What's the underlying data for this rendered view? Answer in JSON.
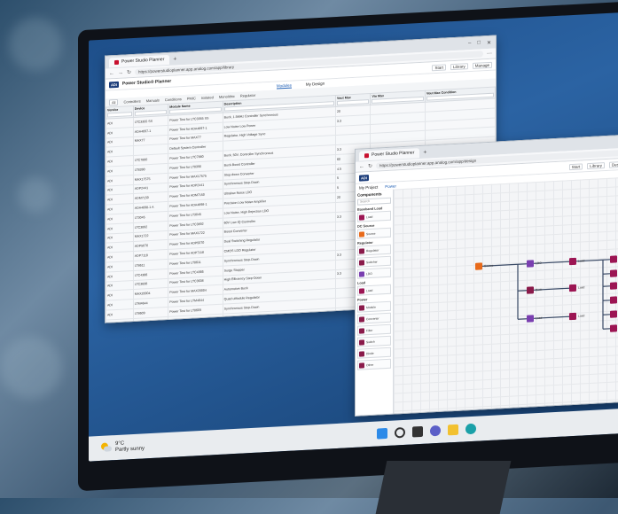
{
  "windowA": {
    "tab_title": "Power Studio Planner",
    "url": "https://powerstudioplanner.app.analog.com/app/library",
    "app_name": "Power Studio® Planner",
    "actions": [
      "Start",
      "Library",
      "Manage"
    ],
    "subtabs": [
      "Modules",
      "My Design"
    ],
    "filters": [
      "All",
      "Controllers",
      "Manuals",
      "Conditions",
      "PMIC",
      "Isolated",
      "Monolithic",
      "Regulator"
    ],
    "columns": [
      "Vendor",
      "Device",
      "Module Name",
      "Description",
      "Vout Max",
      "Vin Max",
      "Vout Max Condition"
    ],
    "rows": [
      [
        "ADI",
        "LTC3355 SS",
        "Power Test for LTC3355 SS",
        "Buck, 1.5MHz Controller Synchronous",
        "20",
        "",
        ""
      ],
      [
        "ADI",
        "ADA4897-1",
        "Power Test for ADA4897-1",
        "Low Noise Low Power",
        "3.3",
        "",
        ""
      ],
      [
        "ADI",
        "MAX77",
        "Power Test for MAX77",
        "Regulator, High Voltage Sync",
        "",
        "",
        ""
      ],
      [
        "ADI",
        "",
        "Default System Controller",
        "",
        "",
        "",
        ""
      ],
      [
        "ADI",
        "LTC7880",
        "Power Test for LTC7880",
        "Buck, 50V, Controller Synchronous",
        "3.3",
        "",
        ""
      ],
      [
        "ADI",
        "LT8390",
        "Power Test for LT8390",
        "Buck-Boost Controller",
        "60",
        "",
        ""
      ],
      [
        "ADI",
        "MAX17575",
        "Power Test for MAX17575",
        "Step-down Converter",
        "4.5",
        "",
        ""
      ],
      [
        "ADI",
        "ADP2441",
        "Power Test for ADP2441",
        "Synchronous Step-Down",
        "5",
        "",
        ""
      ],
      [
        "ADI",
        "ADM7150",
        "Power Test for ADM7150",
        "Ultralow Noise LDO",
        "5",
        "",
        ""
      ],
      [
        "ADI",
        "ADA4898-1 A",
        "Power Test for ADA4898-1",
        "Precision Low Noise Amplifier",
        "20",
        "",
        ""
      ],
      [
        "ADI",
        "LT3045",
        "Power Test for LT3045",
        "Low Noise, High Rejection LDO",
        "",
        "",
        ""
      ],
      [
        "ADI",
        "LTC3892",
        "Power Test for LTC3892",
        "60V Low IQ Controller",
        "3.3",
        "",
        ""
      ],
      [
        "ADI",
        "MAX1722",
        "Power Test for MAX1722",
        "Boost Converter",
        "",
        "",
        ""
      ],
      [
        "ADI",
        "ADP5070",
        "Power Test for ADP5070",
        "Dual Switching Regulator",
        "",
        "",
        ""
      ],
      [
        "ADI",
        "ADP7118",
        "Power Test for ADP7118",
        "CMOS LDO Regulator",
        "",
        "",
        ""
      ],
      [
        "ADI",
        "LT8611",
        "Power Test for LT8611",
        "Synchronous Step-Down",
        "3.3",
        "",
        ""
      ],
      [
        "ADI",
        "LTC4366",
        "Power Test for LTC4366",
        "Surge Stopper",
        "",
        "",
        ""
      ],
      [
        "ADI",
        "LTC3638",
        "Power Test for LTC3638",
        "High Efficiency Step-Down",
        "3.3",
        "",
        ""
      ],
      [
        "ADI",
        "MAX20004",
        "Power Test for MAX20004",
        "Automotive Buck",
        "",
        "",
        ""
      ],
      [
        "ADI",
        "LTM4644",
        "Power Test for LTM4644",
        "Quad uModule Regulator",
        "",
        "",
        ""
      ],
      [
        "ADI",
        "LT8609",
        "Power Test for LT8609",
        "Synchronous Step-Down",
        "",
        "",
        ""
      ],
      [
        "ADI",
        "ADP1755",
        "Power Test for ADP1755",
        "Low Dropout Regulator",
        "",
        "",
        ""
      ],
      [
        "ADI",
        "LTC3315",
        "Power Test for LTC3315",
        "Dual Buck",
        "",
        "",
        ""
      ],
      [
        "ADI",
        "LT3080",
        "Power Test for LT3080",
        "Adjustable LDO",
        "",
        "",
        ""
      ]
    ]
  },
  "windowB": {
    "tab_title": "Power Studio Planner",
    "url": "https://powerstudioplanner.app.analog.com/app/design",
    "actions": [
      "Start",
      "Library",
      "Design"
    ],
    "toolbar": [
      "My Project",
      "Power"
    ],
    "palette_title": "Components",
    "search_placeholder": "Search",
    "sections": [
      "Baseband Load",
      "DC Source",
      "Regulator",
      "Load",
      "Power"
    ],
    "items": [
      "Load",
      "Source",
      "Regulator",
      "Switcher",
      "LDO",
      "Load",
      "Module",
      "Converter",
      "Filter",
      "Switch",
      "Diode",
      "Other"
    ],
    "nodes": [
      "Source",
      "LDO",
      "Buck",
      "Load",
      "Load",
      "Load",
      "Load",
      "Load",
      "Load",
      "Load",
      "Load",
      "Load",
      "Load"
    ]
  },
  "taskbar": {
    "temperature": "9°C",
    "weather": "Partly sunny"
  },
  "colors": {
    "regulator": "#8a1a4a",
    "source": "#e86a1a",
    "ldo": "#7a3fb0",
    "load": "#9c1553",
    "accent": "#1f5fb5"
  }
}
